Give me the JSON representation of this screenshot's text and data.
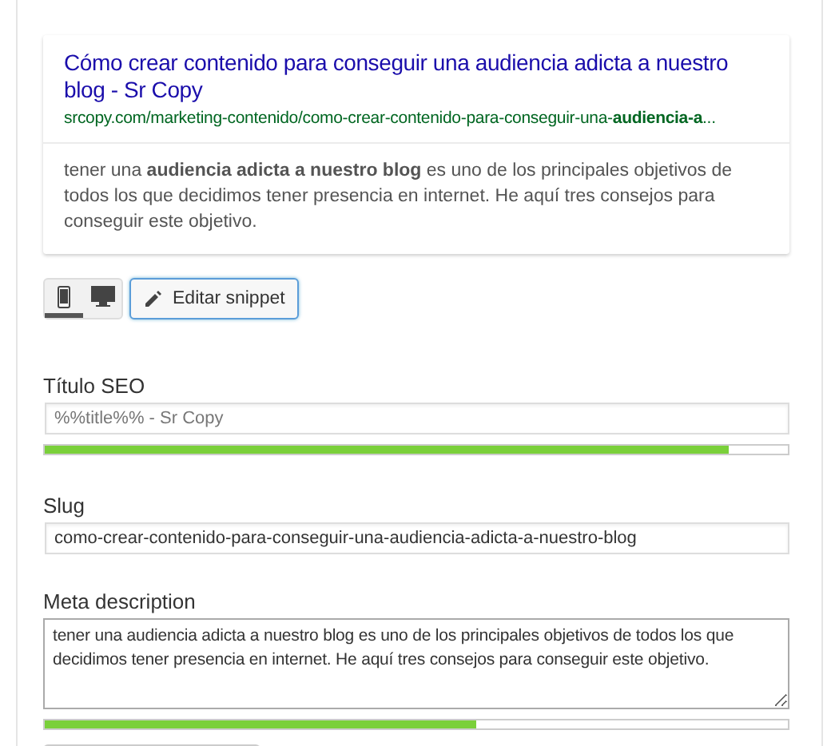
{
  "snippet_preview": {
    "title": "Cómo crear contenido para conseguir una audiencia adicta a nuestro blog - Sr Copy",
    "url": "srcopy.com/marketing-contenido/como-crear-contenido-para-conseguir-una-**audiencia-a**...",
    "description": "tener una **audiencia adicta a nuestro blog** es uno de los principales objetivos de todos los que decidimos tener presencia en internet. He aquí tres consejos para conseguir este objetivo."
  },
  "view_toggle": [
    {
      "kind": "mobile",
      "selected": true
    },
    {
      "kind": "desktop",
      "selected": false
    }
  ],
  "edit_button": {
    "label": "Editar snippet"
  },
  "fields": [
    {
      "kind": "input",
      "label": "Título SEO",
      "placeholder": "%%title%% - Sr Copy",
      "level": 0.92
    },
    {
      "kind": "input",
      "label": "Slug",
      "value": "como-crear-contenido-para-conseguir-una-audiencia-adicta-a-nuestro-blog"
    },
    {
      "kind": "textarea",
      "label": "Meta description",
      "value": "tener una audiencia adicta a nuestro blog es uno de los principales objetivos de todos los que decidimos tener presencia en internet. He aquí tres consejos para conseguir este objetivo.",
      "level": 0.58
    }
  ]
}
